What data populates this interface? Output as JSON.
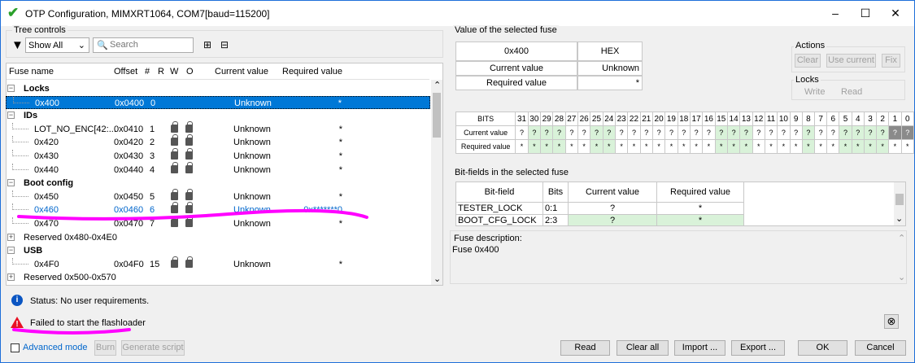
{
  "window": {
    "title": "OTP Configuration, MIMXRT1064, COM7[baud=115200]",
    "minimize": "–",
    "maximize": "☐",
    "close": "✕"
  },
  "tree": {
    "group_label": "Tree controls",
    "filter": "Show All",
    "search_placeholder": "Search",
    "expand_all": "⊞",
    "collapse_all": "⊟",
    "headers": {
      "name": "Fuse name",
      "offset": "Offset",
      "index": "#",
      "r": "R",
      "w": "W",
      "o": "O",
      "current": "Current value",
      "required": "Required value"
    }
  },
  "rows": [
    {
      "kind": "group",
      "name": "Locks",
      "exp": "−"
    },
    {
      "kind": "fuse",
      "name": "0x400",
      "offset": "0x0400",
      "index": "0",
      "current": "Unknown",
      "required": "*",
      "selected": true,
      "locks": false
    },
    {
      "kind": "group",
      "name": "IDs",
      "exp": "−"
    },
    {
      "kind": "fuse",
      "name": "LOT_NO_ENC[42:...",
      "offset": "0x0410",
      "index": "1",
      "current": "Unknown",
      "required": "*",
      "locks": true
    },
    {
      "kind": "fuse",
      "name": "0x420",
      "offset": "0x0420",
      "index": "2",
      "current": "Unknown",
      "required": "*",
      "locks": true
    },
    {
      "kind": "fuse",
      "name": "0x430",
      "offset": "0x0430",
      "index": "3",
      "current": "Unknown",
      "required": "*",
      "locks": true
    },
    {
      "kind": "fuse",
      "name": "0x440",
      "offset": "0x0440",
      "index": "4",
      "current": "Unknown",
      "required": "*",
      "locks": true
    },
    {
      "kind": "group",
      "name": "Boot config",
      "exp": "−"
    },
    {
      "kind": "fuse",
      "name": "0x450",
      "offset": "0x0450",
      "index": "5",
      "current": "Unknown",
      "required": "*",
      "locks": true
    },
    {
      "kind": "fuse",
      "name": "0x460",
      "offset": "0x0460",
      "index": "6",
      "current": "Unknown",
      "required": "0x*******0",
      "locks": true,
      "blue": true
    },
    {
      "kind": "fuse",
      "name": "0x470",
      "offset": "0x0470",
      "index": "7",
      "current": "Unknown",
      "required": "*",
      "locks": true
    },
    {
      "kind": "collapsed",
      "name": "Reserved 0x480-0x4E0",
      "exp": "+"
    },
    {
      "kind": "group",
      "name": "USB",
      "exp": "−"
    },
    {
      "kind": "fuse",
      "name": "0x4F0",
      "offset": "0x04F0",
      "index": "15",
      "current": "Unknown",
      "required": "*",
      "locks": true
    },
    {
      "kind": "collapsed",
      "name": "Reserved 0x500-0x570",
      "exp": "+"
    }
  ],
  "selected_fuse": {
    "group_label": "Value of the selected fuse",
    "name": "0x400",
    "format": "HEX",
    "current_label": "Current value",
    "current": "Unknown",
    "required_label": "Required value",
    "required": "*"
  },
  "actions": {
    "label": "Actions",
    "clear": "Clear",
    "use_current": "Use current",
    "fix": "Fix"
  },
  "locks_group": {
    "label": "Locks",
    "write": "Write",
    "read": "Read"
  },
  "bits": {
    "header": "BITS",
    "current_label": "Current value",
    "required_label": "Required value",
    "numbers": [
      "31",
      "30",
      "29",
      "28",
      "27",
      "26",
      "25",
      "24",
      "23",
      "22",
      "21",
      "20",
      "19",
      "18",
      "17",
      "16",
      "15",
      "14",
      "13",
      "12",
      "11",
      "10",
      "9",
      "8",
      "7",
      "6",
      "5",
      "4",
      "3",
      "2",
      "1",
      "0"
    ],
    "current": [
      "?",
      "?",
      "?",
      "?",
      "?",
      "?",
      "?",
      "?",
      "?",
      "?",
      "?",
      "?",
      "?",
      "?",
      "?",
      "?",
      "?",
      "?",
      "?",
      "?",
      "?",
      "?",
      "?",
      "?",
      "?",
      "?",
      "?",
      "?",
      "?",
      "?",
      "?",
      "?"
    ],
    "required": [
      "*",
      "*",
      "*",
      "*",
      "*",
      "*",
      "*",
      "*",
      "*",
      "*",
      "*",
      "*",
      "*",
      "*",
      "*",
      "*",
      "*",
      "*",
      "*",
      "*",
      "*",
      "*",
      "*",
      "*",
      "*",
      "*",
      "*",
      "*",
      "*",
      "*",
      "*",
      "*"
    ],
    "green_cols": [
      1,
      2,
      3,
      6,
      7,
      16,
      17,
      18,
      23,
      26,
      27,
      28,
      29
    ],
    "gray_cols": [
      30,
      31
    ]
  },
  "bitfields": {
    "group_label": "Bit-fields in the selected fuse",
    "headers": {
      "field": "Bit-field",
      "bits": "Bits",
      "current": "Current value",
      "required": "Required value"
    },
    "rows": [
      {
        "field": "TESTER_LOCK",
        "bits": "0:1",
        "current": "?",
        "required": "*"
      },
      {
        "field": "BOOT_CFG_LOCK",
        "bits": "2:3",
        "current": "?",
        "required": "*"
      }
    ]
  },
  "description": {
    "label": "Fuse description:",
    "text": "Fuse 0x400"
  },
  "status": {
    "info": "Status: No user requirements.",
    "error": "Failed to start the flashloader"
  },
  "footer": {
    "advanced": "Advanced mode",
    "burn": "Burn",
    "generate": "Generate script",
    "read": "Read",
    "clear_all": "Clear all",
    "import": "Import ...",
    "export": "Export ...",
    "ok": "OK",
    "cancel": "Cancel"
  },
  "colors": {
    "selection": "#0078d7",
    "accent_green": "#d9f2d9",
    "annotation": "#ff00ff",
    "link": "#0066cc"
  }
}
